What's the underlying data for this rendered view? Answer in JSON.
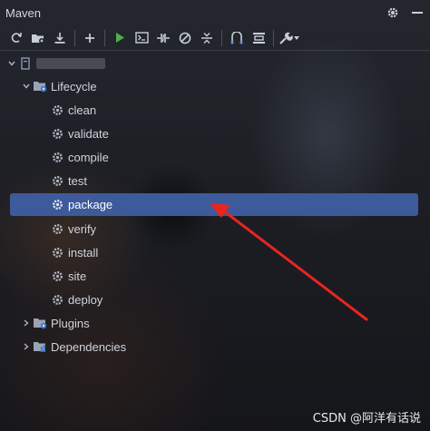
{
  "window": {
    "title": "Maven"
  },
  "titlebar_icons": [
    "gear-icon",
    "minimize-icon"
  ],
  "toolbar": {
    "buttons": [
      "reload-icon",
      "generate-sources-icon",
      "download-icon",
      "add-icon",
      "run-icon",
      "execute-goal-icon",
      "toggle-offline-icon",
      "skip-tests-icon",
      "collapse-all-icon",
      "show-dependencies-icon",
      "settings-icon",
      "wrench-icon"
    ]
  },
  "tree": {
    "project_name": "",
    "lifecycle": {
      "label": "Lifecycle",
      "items": [
        {
          "label": "clean"
        },
        {
          "label": "validate"
        },
        {
          "label": "compile"
        },
        {
          "label": "test"
        },
        {
          "label": "package",
          "selected": true
        },
        {
          "label": "verify"
        },
        {
          "label": "install"
        },
        {
          "label": "site"
        },
        {
          "label": "deploy"
        }
      ]
    },
    "plugins": {
      "label": "Plugins"
    },
    "dependencies": {
      "label": "Dependencies"
    }
  },
  "watermark": "CSDN @阿洋有话说",
  "annotation": {
    "color": "#e8251f"
  }
}
